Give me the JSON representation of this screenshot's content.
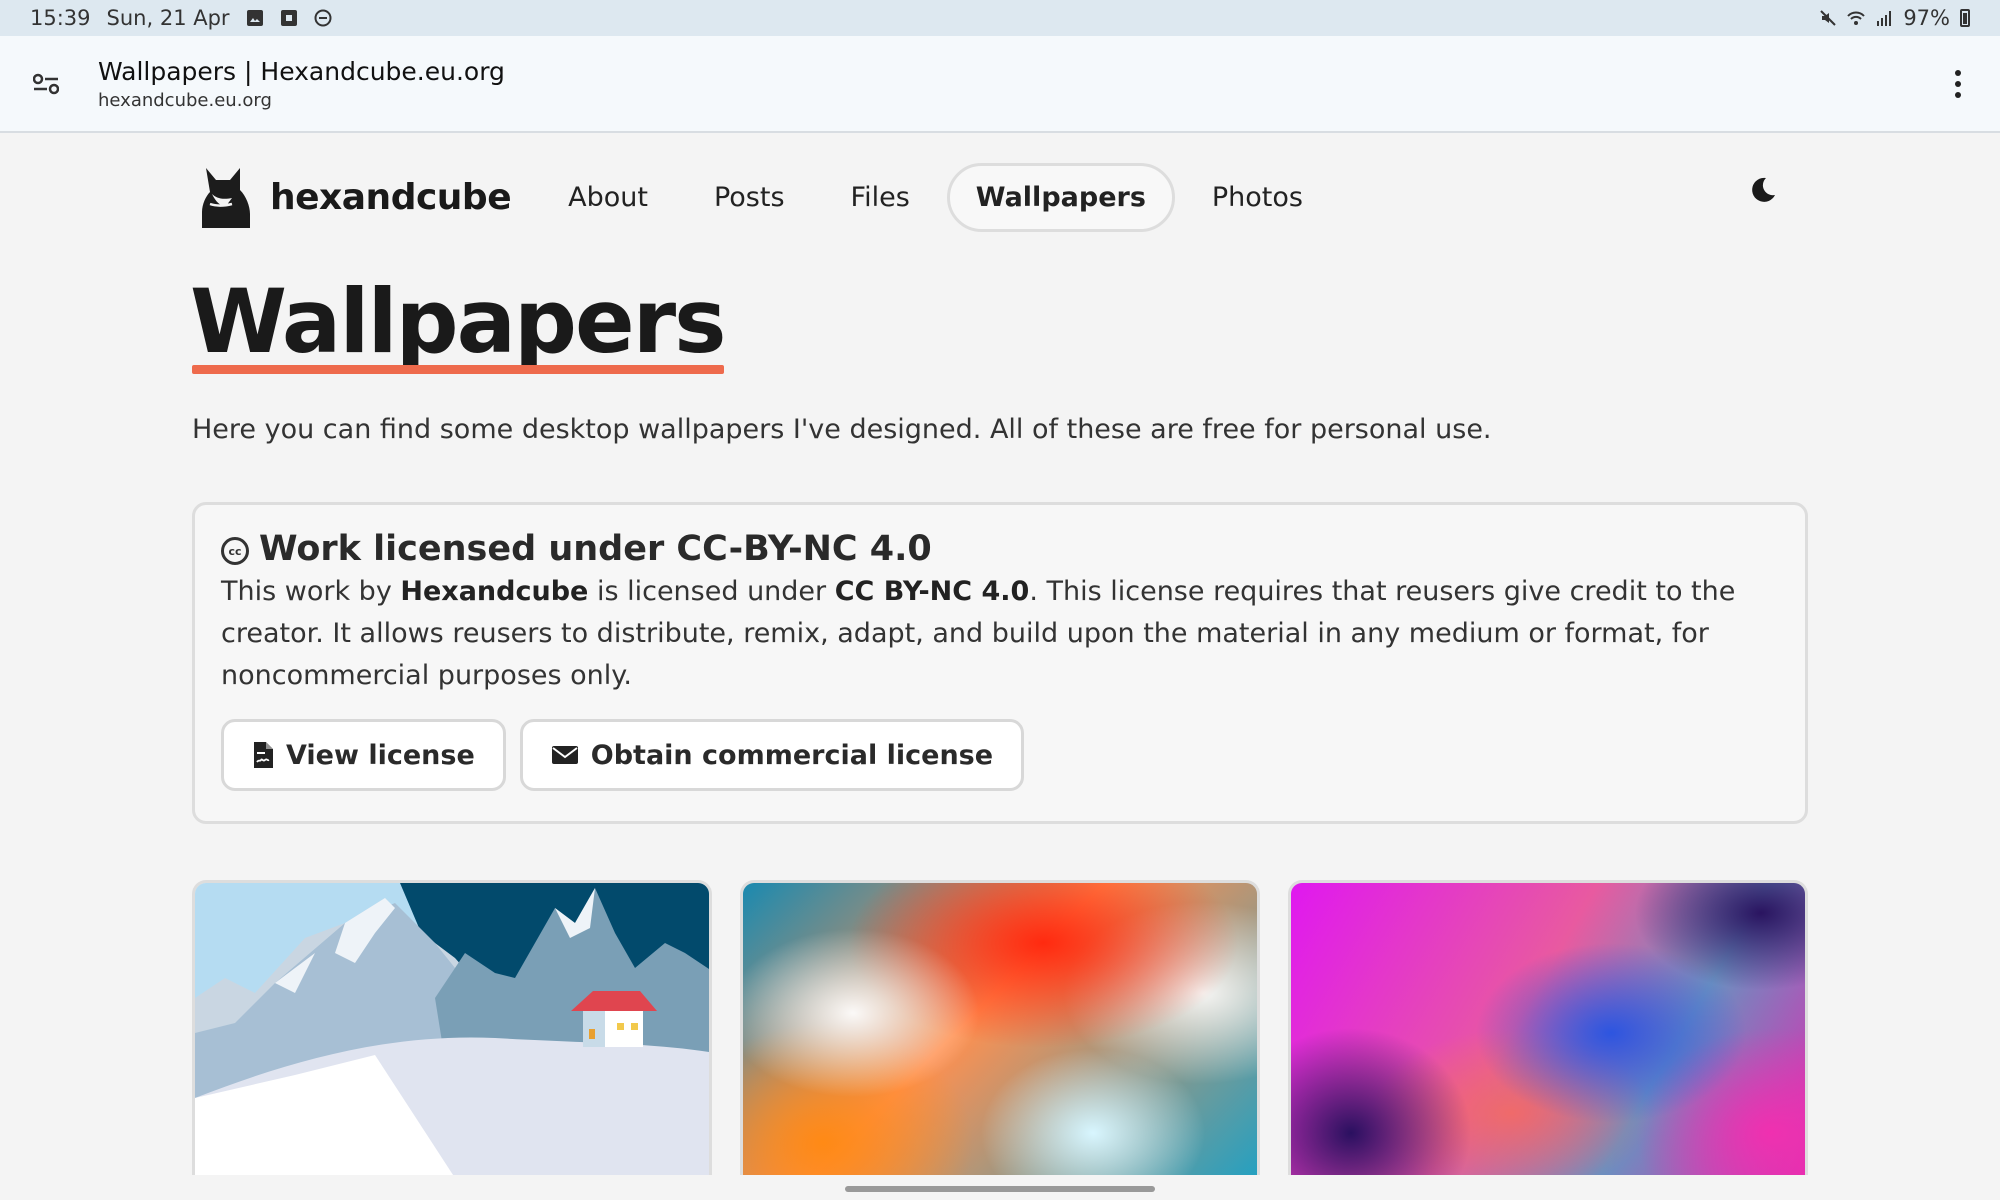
{
  "status_bar": {
    "time": "15:39",
    "date": "Sun, 21 Apr",
    "icons": [
      "image-icon",
      "screenshot-icon",
      "dnd-icon"
    ],
    "right_icons": [
      "mute-icon",
      "wifi-icon",
      "signal-icon"
    ],
    "battery": "97%"
  },
  "browser": {
    "title": "Wallpapers | Hexandcube.eu.org",
    "url": "hexandcube.eu.org"
  },
  "nav": {
    "brand": "hexandcube",
    "links": [
      {
        "label": "About"
      },
      {
        "label": "Posts"
      },
      {
        "label": "Files"
      },
      {
        "label": "Wallpapers",
        "active": true
      },
      {
        "label": "Photos"
      }
    ]
  },
  "page": {
    "title": "Wallpapers",
    "intro": "Here you can find some desktop wallpapers I've designed. All of these are free for personal use."
  },
  "license": {
    "title": "Work licensed under CC-BY-NC 4.0",
    "cc_icon_text": "cc",
    "text_1": "This work by ",
    "author": "Hexandcube",
    "text_2": " is licensed under ",
    "license_name": "CC BY-NC 4.0",
    "text_3": ". This license requires that reusers give credit to the creator. It allows reusers to distribute, remix, adapt, and build upon the material in any medium or format, for noncommercial purposes only.",
    "view_button": "View license",
    "commercial_button": "Obtain commercial license"
  },
  "colors": {
    "accent_underline": "#ee6a4c"
  }
}
